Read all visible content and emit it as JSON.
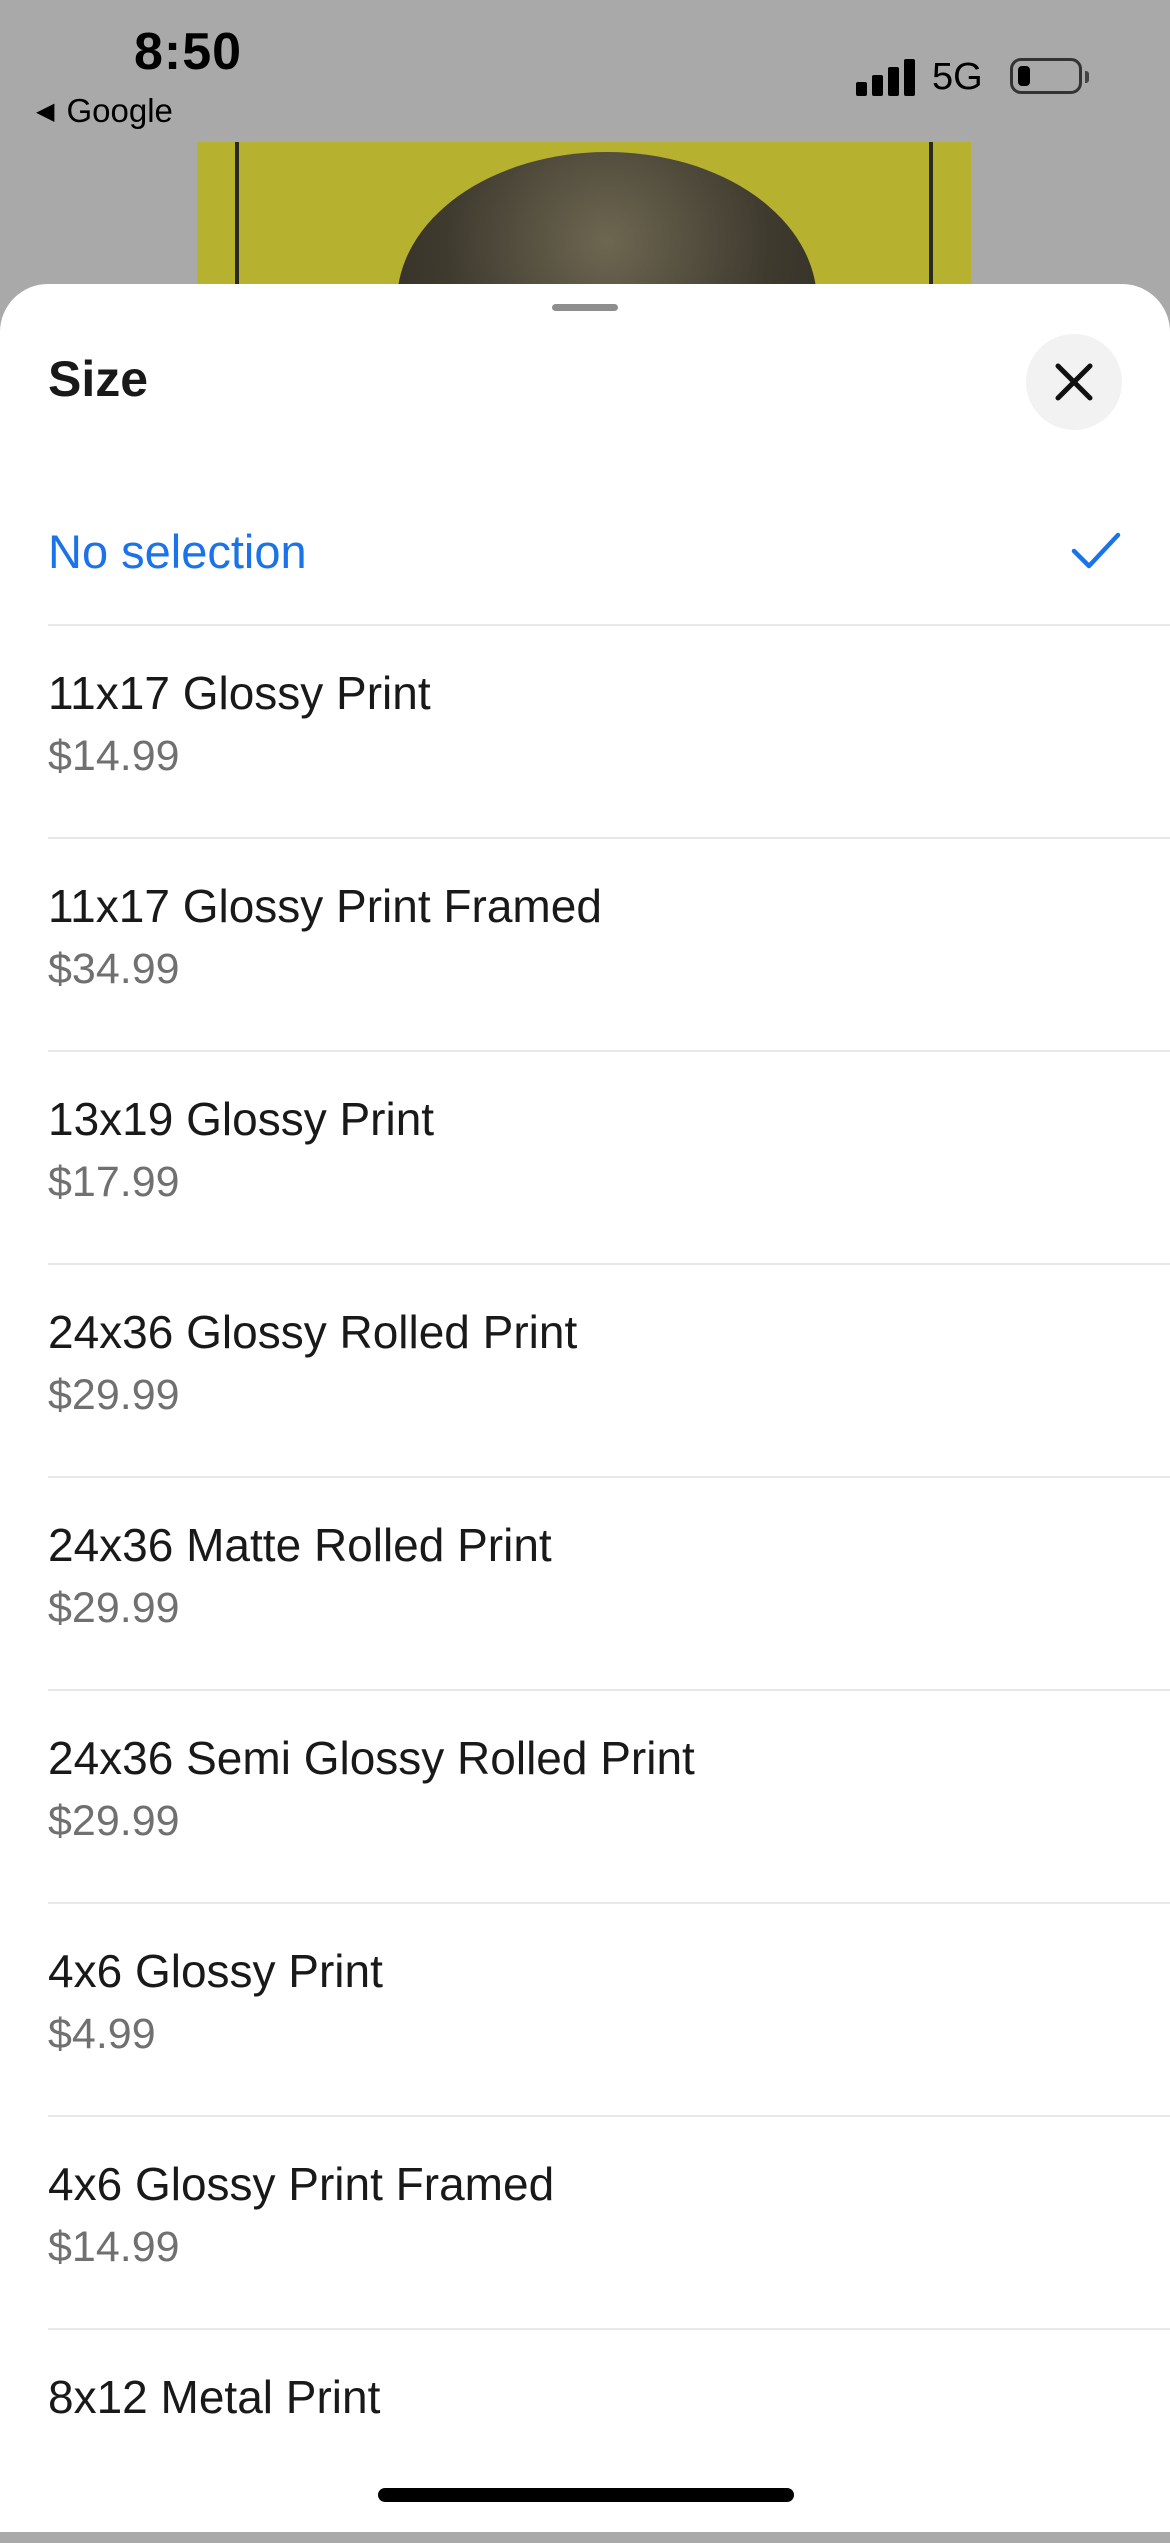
{
  "status_bar": {
    "time": "8:50",
    "back_app": "Google",
    "network": "5G"
  },
  "sheet": {
    "title": "Size",
    "no_selection_label": "No selection",
    "options": [
      {
        "name": "11x17 Glossy Print",
        "price": "$14.99"
      },
      {
        "name": "11x17 Glossy Print Framed",
        "price": "$34.99"
      },
      {
        "name": "13x19 Glossy Print",
        "price": "$17.99"
      },
      {
        "name": "24x36 Glossy Rolled Print",
        "price": "$29.99"
      },
      {
        "name": "24x36 Matte Rolled Print",
        "price": "$29.99"
      },
      {
        "name": "24x36 Semi Glossy Rolled Print",
        "price": "$29.99"
      },
      {
        "name": "4x6 Glossy Print",
        "price": "$4.99"
      },
      {
        "name": "4x6 Glossy Print Framed",
        "price": "$14.99"
      },
      {
        "name": "8x12 Metal Print",
        "price": ""
      }
    ]
  },
  "colors": {
    "accent": "#1a73e8",
    "price_gray": "#707070",
    "backdrop_gray": "#a9a9a9"
  }
}
